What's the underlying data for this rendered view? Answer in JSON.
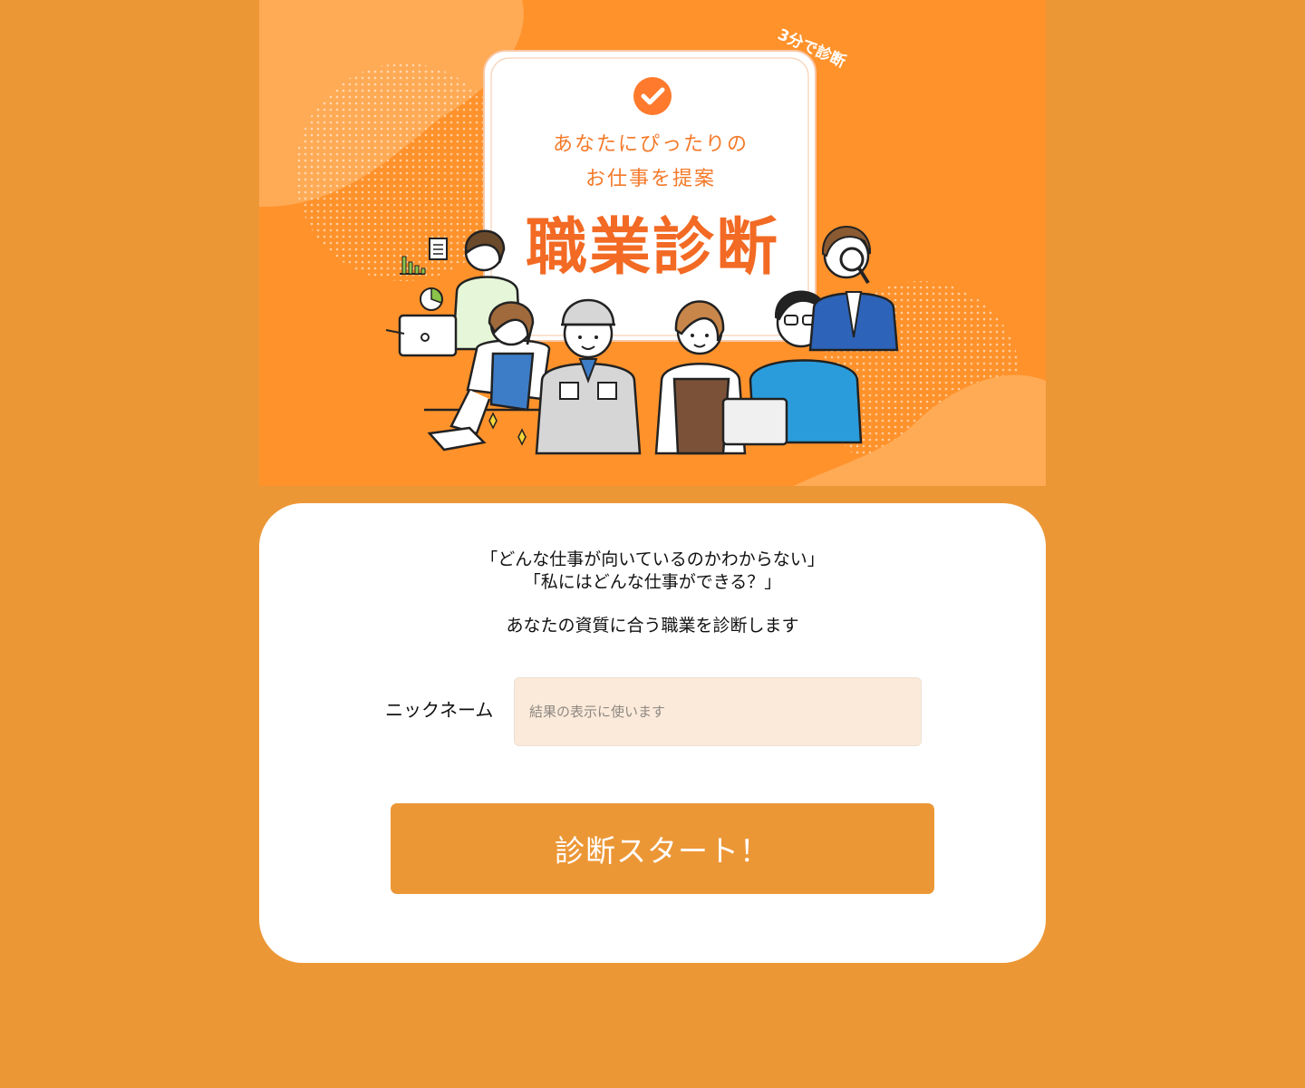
{
  "colors": {
    "page_background": "#EC9736",
    "hero_background": "#FF922B",
    "hero_text_accent": "#F47A2A",
    "card_background": "#FFFFFF",
    "input_background": "#FBEADA",
    "button_background": "#EC9736",
    "button_text": "#FFFFFF"
  },
  "hero": {
    "badge": "3分で診断",
    "check_icon": "check-circle-icon",
    "tagline_line1": "あなたにぴったりの",
    "tagline_line2": "お仕事を提案",
    "title": "職業診断"
  },
  "intro": {
    "line1": "「どんな仕事が向いているのかわからない」",
    "line2": "「私にはどんな仕事ができる？」",
    "line3": "あなたの資質に合う職業を診断します"
  },
  "form": {
    "nickname_label": "ニックネーム",
    "nickname_placeholder": "結果の表示に使います",
    "nickname_value": "",
    "start_button_label": "診断スタート！"
  }
}
